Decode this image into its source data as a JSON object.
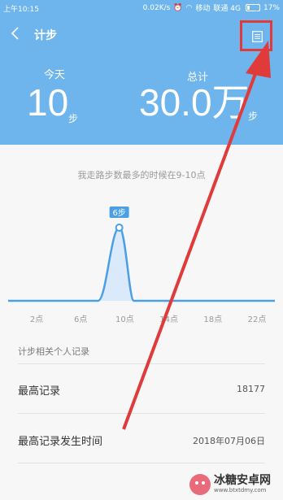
{
  "status_bar": {
    "time": "上午10:15",
    "speed": "0.02K/s",
    "carrier1": "移动",
    "carrier2": "联通 4G",
    "battery": "17%"
  },
  "header": {
    "title": "计步",
    "today_label": "今天",
    "today_value": "10",
    "today_unit": "步",
    "total_label": "总计",
    "total_value": "30.0万",
    "total_unit": "步"
  },
  "hint": "我走路步数最多的时候在9-10点",
  "chart_data": {
    "type": "area",
    "x_ticks": [
      "2点",
      "6点",
      "10点",
      "14点",
      "18点",
      "22点"
    ],
    "peak_label": "6步",
    "peak_hour": 9.5,
    "peak_value": 6
  },
  "records": {
    "section_title": "计步相关个人记录",
    "rows": [
      {
        "label": "最高记录",
        "value": "18177"
      },
      {
        "label": "最高记录发生时间",
        "value": "2018年07月06日"
      }
    ]
  },
  "watermark": {
    "title": "冰糖安卓网",
    "url": "www.btxtdmy.com"
  },
  "colors": {
    "header_bg": "#6db5ec",
    "accent": "#4a9fe6",
    "annotation": "#e03a3a"
  }
}
